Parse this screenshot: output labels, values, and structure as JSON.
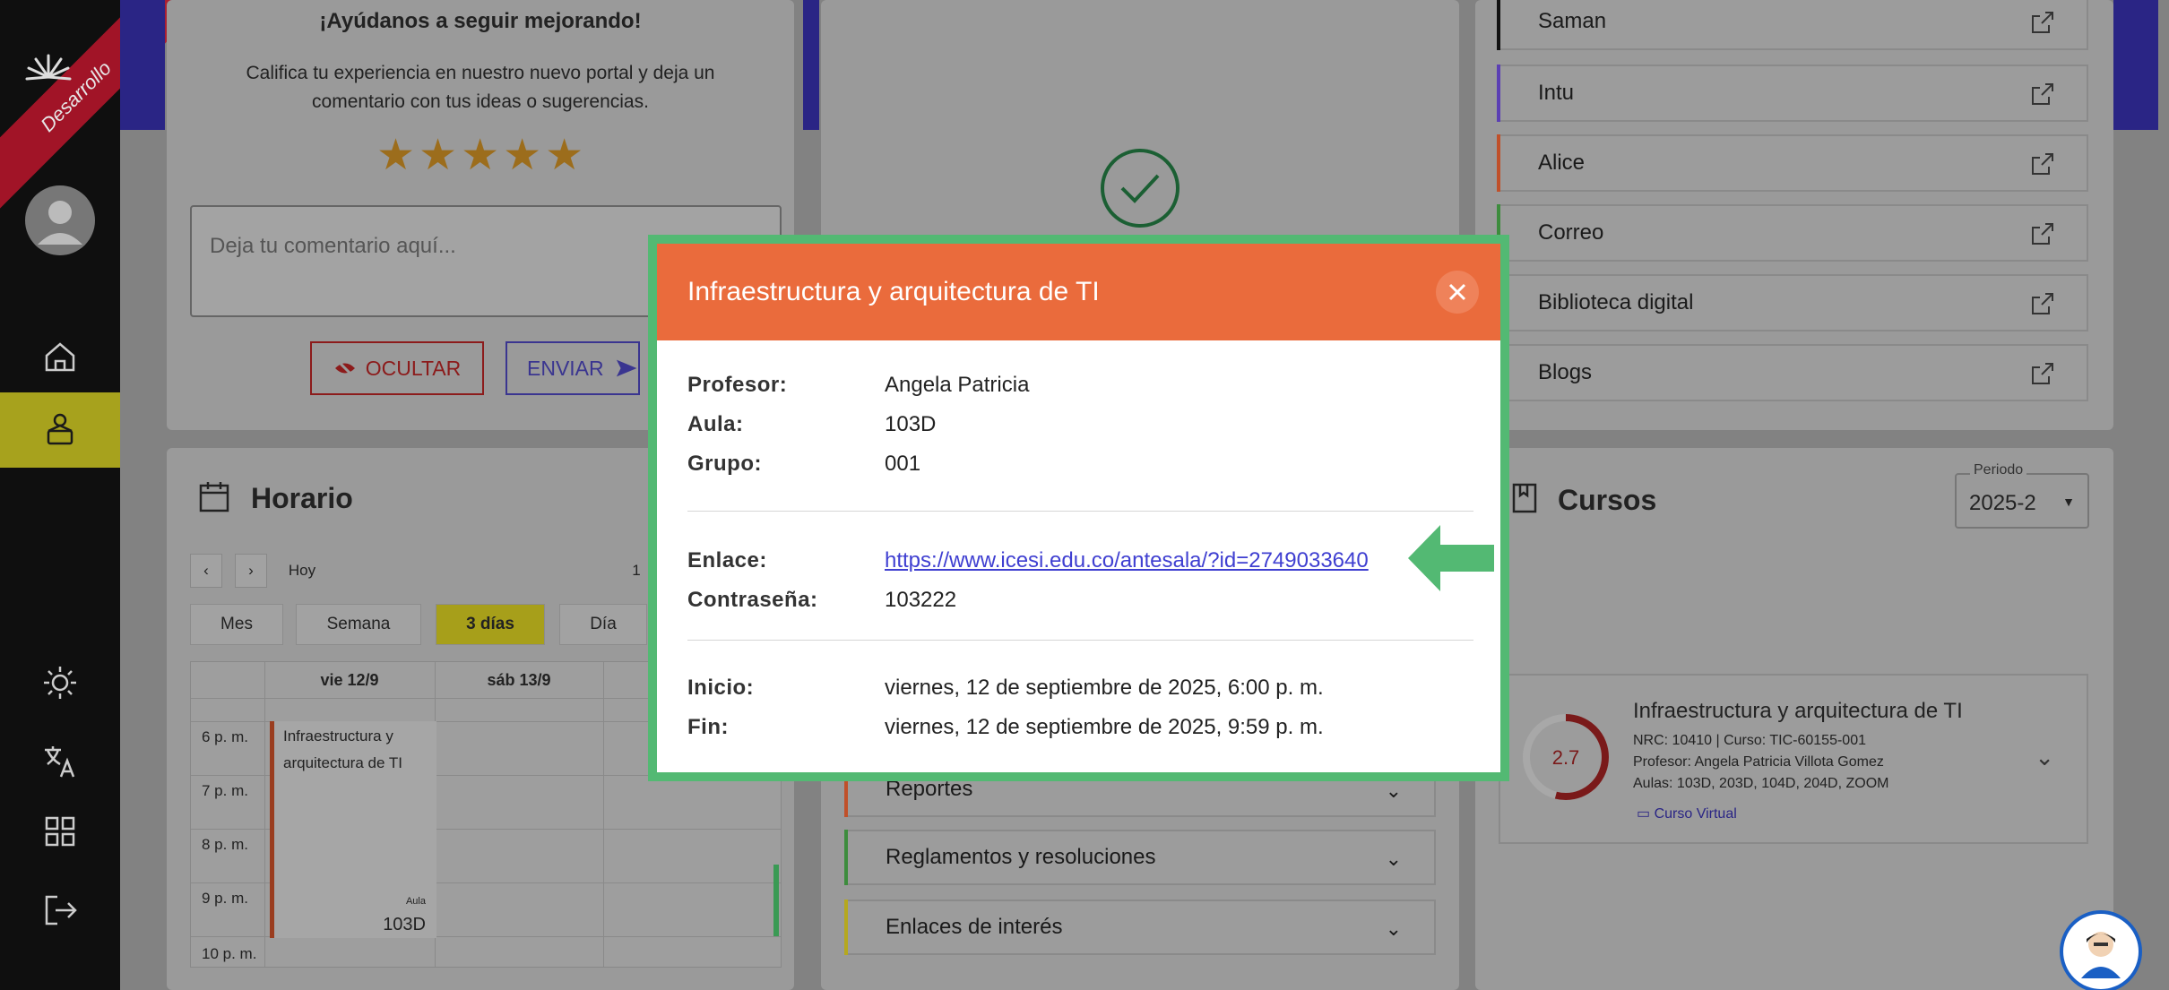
{
  "sidebar": {
    "ribbon_label": "Desarrollo"
  },
  "feedback": {
    "title": "¡Ayúdanos a seguir mejorando!",
    "description": "Califica tu experiencia en nuestro nuevo portal y deja un comentario con tus ideas o sugerencias.",
    "rating": 5,
    "comment_placeholder": "Deja tu comentario aquí...",
    "hide_label": "OCULTAR",
    "send_label": "ENVIAR"
  },
  "links": [
    {
      "label": "Saman",
      "color": "#111111"
    },
    {
      "label": "Intu",
      "color": "#5b3fb4"
    },
    {
      "label": "Alice",
      "color": "#c0502a"
    },
    {
      "label": "Correo",
      "color": "#3d8c3d"
    },
    {
      "label": "Biblioteca digital",
      "color": "#9a9a9a"
    },
    {
      "label": "Blogs",
      "color": "#9a9a9a"
    }
  ],
  "schedule": {
    "title": "Horario",
    "nav_prev": "‹",
    "nav_next": "›",
    "today_label": "Hoy",
    "date_fragment": "1",
    "views": [
      "Mes",
      "Semana",
      "3 días",
      "Día"
    ],
    "selected_view": "3 días",
    "columns": [
      "vie 12/9",
      "sáb 13/9"
    ],
    "hours": [
      "6 p. m.",
      "7 p. m.",
      "8 p. m.",
      "9 p. m.",
      "10 p. m."
    ],
    "event": {
      "title": "Infraestructura y arquitectura de TI",
      "aula_label": "Aula",
      "aula": "103D"
    }
  },
  "accordion": [
    {
      "label": "Reportes",
      "color": "#c0502a"
    },
    {
      "label": "Reglamentos y resoluciones",
      "color": "#3d8c3d"
    },
    {
      "label": "Enlaces de interés",
      "color": "#b5a81e"
    }
  ],
  "courses": {
    "title": "Cursos",
    "period_label": "Periodo",
    "period_value": "2025-2",
    "course": {
      "name": "Infraestructura y arquitectura de TI",
      "grade": "2.7",
      "nrc_line": "NRC: 10410 | Curso: TIC-60155-001",
      "profesor_line": "Profesor: Angela Patricia Villota Gomez",
      "aulas_line": "Aulas: 103D, 203D, 104D, 204D, ZOOM",
      "virtual_label": "Curso Virtual"
    }
  },
  "modal": {
    "title": "Infraestructura y arquitectura de TI",
    "profesor_label": "Profesor:",
    "profesor": "Angela Patricia",
    "aula_label": "Aula:",
    "aula": "103D",
    "grupo_label": "Grupo:",
    "grupo": "001",
    "enlace_label": "Enlace:",
    "enlace": "https://www.icesi.edu.co/antesala/?id=2749033640",
    "contrasena_label": "Contraseña:",
    "contrasena": "103222",
    "inicio_label": "Inicio:",
    "inicio": "viernes, 12 de septiembre de 2025, 6:00 p. m.",
    "fin_label": "Fin:",
    "fin": "viernes, 12 de septiembre de 2025, 9:59 p. m."
  },
  "colors": {
    "modal_header": "#ea6b3c",
    "modal_border": "#53b973",
    "accent_yellow": "#a7a21d",
    "link_blue": "#3f3fd1"
  }
}
